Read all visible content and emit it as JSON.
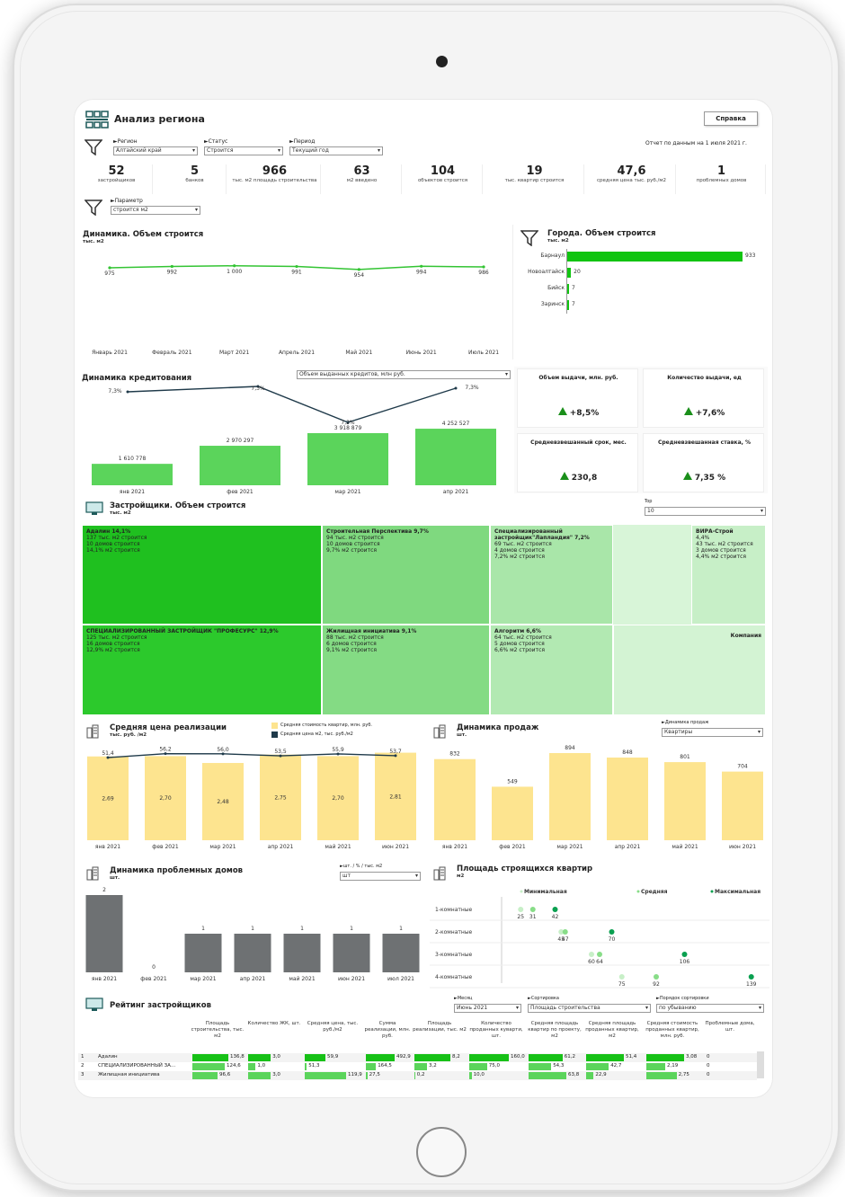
{
  "header": {
    "title": "Анализ региона",
    "help_button": "Справка",
    "report_date": "Отчет по данным на 1 июля 2021 г."
  },
  "filters": {
    "region": {
      "label": "►Регион",
      "value": "Алтайский край"
    },
    "status": {
      "label": "►Статус",
      "value": "Строится"
    },
    "period": {
      "label": "►Период",
      "value": "Текущий год"
    },
    "param": {
      "label": "►Параметр",
      "value": "строится м2"
    }
  },
  "kpis": [
    {
      "value": "52",
      "label": "застройщиков"
    },
    {
      "value": "5",
      "label": "банков"
    },
    {
      "value": "966",
      "label": "тыс. м2 площадь строительства"
    },
    {
      "value": "63",
      "label": "м2 введено"
    },
    {
      "value": "104",
      "label": "объектов строится"
    },
    {
      "value": "19",
      "label": "тыс. квартир строится"
    },
    {
      "value": "47,6",
      "label": "средняя цена тыс. руб./м2"
    },
    {
      "value": "1",
      "label": "проблемных домов"
    }
  ],
  "dynamics": {
    "title": "Динамика. Объем строится",
    "unit": "тыс. м2",
    "chart_data": {
      "type": "line",
      "categories": [
        "Январь 2021",
        "Февраль 2021",
        "Март 2021",
        "Апрель 2021",
        "Май 2021",
        "Июнь 2021",
        "Июль 2021"
      ],
      "values": [
        975,
        992,
        1000,
        991,
        954,
        994,
        986
      ],
      "labels": [
        "975",
        "992",
        "1 000",
        "991",
        "954",
        "994",
        "986"
      ],
      "ylim": [
        0,
        1100
      ]
    }
  },
  "cities": {
    "title": "Города. Объем строится",
    "unit": "тыс. м2",
    "chart_data": {
      "type": "bar",
      "categories": [
        "Барнаул",
        "Новоалтайск",
        "Бийск",
        "Заринск"
      ],
      "values": [
        933,
        20,
        7,
        7
      ]
    }
  },
  "credit": {
    "title": "Динамика кредитования",
    "dropdown": "Объем выданных кредитов, млн руб.",
    "chart_data": {
      "type": "bar",
      "categories": [
        "янв 2021",
        "фев 2021",
        "мар 2021",
        "апр 2021"
      ],
      "values": [
        1610778,
        2970297,
        3918879,
        4252527
      ],
      "labels": [
        "1 610 778",
        "2 970 297",
        "3 918 879",
        "4 252 527"
      ],
      "rate_line": [
        7.3,
        7.3,
        7.2,
        7.3
      ],
      "rate_labels": [
        "7,3%",
        "7,3%",
        "7,2%",
        "7,3%"
      ]
    }
  },
  "credit_kpis": [
    {
      "title": "Объем выдачи, млн. руб.",
      "value": "+8,5%"
    },
    {
      "title": "Количество выдачи, ед",
      "value": "+7,6%"
    },
    {
      "title": "Средневзвешанный срок, мес.",
      "value": "230,8"
    },
    {
      "title": "Средневзвешанная ставка, %",
      "value": "7,35 %"
    }
  ],
  "developers": {
    "title": "Застройщики. Объем строится",
    "unit": "тыс. м2",
    "top_label": "Top",
    "top_value": "10",
    "cells": [
      {
        "name": "Адалин  14,1%",
        "l1": "137 тыс. м2 строится",
        "l2": "10 домов строится",
        "l3": "14,1%  м2 строится",
        "color": "#1fc01f"
      },
      {
        "name": "СПЕЦИАЛИЗИРОВАННЫЙ ЗАСТРОЙЩИК \"ПРОФЕСУРС\"  12,9%",
        "l1": "125 тыс. м2 строится",
        "l2": "16 домов строится",
        "l3": "12,9%  м2 строится",
        "color": "#2cc92c"
      },
      {
        "name": "Строительная Перспектива  9,7%",
        "l1": "94 тыс. м2 строится",
        "l2": "10 домов строится",
        "l3": "9,7%  м2 строится",
        "color": "#7fd97f"
      },
      {
        "name": "Жилищная инициатива  9,1%",
        "l1": "88 тыс. м2 строится",
        "l2": "6 домов строится",
        "l3": "9,1%  м2 строится",
        "color": "#84db84"
      },
      {
        "name": "Специализированный застройщик\"Лапландия\"  7,2%",
        "l1": "69 тыс. м2 строится",
        "l2": "4 домов строится",
        "l3": "7,2%  м2 строится",
        "color": "#a9e6a9"
      },
      {
        "name": "Алгоритм  6,6%",
        "l1": "64 тыс. м2 строится",
        "l2": "5 домов строится",
        "l3": "6,6%  м2 строится",
        "color": "#b2e9b2"
      },
      {
        "name": "ВИРА-Строй",
        "l1": "4,4%",
        "l2": "43 тыс. м2 строится",
        "l3": "3 домов строится",
        "l4": "4,4%  м2 строится",
        "color": "#c7efc7"
      },
      {
        "name": "Компания",
        "color": "#d3f3d3"
      }
    ]
  },
  "avg_price": {
    "title": "Средняя цена реализации",
    "unit": "тыс. руб. /м2",
    "legend1": "Средняя стоимость квартир, млн. руб.",
    "legend2": "Средняя цена м2, тыс. руб./м2",
    "chart_data": {
      "type": "bar",
      "categories": [
        "янв 2021",
        "фев 2021",
        "мар 2021",
        "апр 2021",
        "май 2021",
        "июн 2021"
      ],
      "series": [
        {
          "name": "Средняя стоимость квартир, млн. руб.",
          "values": [
            2.69,
            2.7,
            2.48,
            2.75,
            2.7,
            2.81
          ],
          "labels": [
            "2,69",
            "2,70",
            "2,48",
            "2,75",
            "2,70",
            "2,81"
          ]
        },
        {
          "name": "Средняя цена м2, тыс. руб./м2",
          "values": [
            51.4,
            56.2,
            56.0,
            53.5,
            55.9,
            53.7
          ],
          "labels": [
            "51,4",
            "56,2",
            "56,0",
            "53,5",
            "55,9",
            "53,7"
          ]
        }
      ]
    }
  },
  "sales": {
    "title": "Динамика продаж",
    "unit": "шт.",
    "dd_label": "►Динамика продаж",
    "dd_value": "Квартиры",
    "chart_data": {
      "type": "bar",
      "categories": [
        "янв 2021",
        "фев 2021",
        "мар 2021",
        "апр 2021",
        "май 2021",
        "июн 2021"
      ],
      "values": [
        832,
        549,
        894,
        848,
        801,
        704
      ]
    }
  },
  "problem": {
    "title": "Динамика проблемных домов",
    "unit": "шт.",
    "dd_label": "►шт. / % / тыс. м2",
    "dd_value": "шт",
    "chart_data": {
      "type": "bar",
      "categories": [
        "янв 2021",
        "фев 2021",
        "мар 2021",
        "апр 2021",
        "май 2021",
        "июн 2021",
        "июл 2021"
      ],
      "values": [
        2,
        0,
        1,
        1,
        1,
        1,
        1
      ]
    }
  },
  "area": {
    "title": "Площадь строящихся квартир",
    "unit": "м2",
    "leg_min": "Минимальная",
    "leg_avg": "Средняя",
    "leg_max": "Максимальная",
    "chart_data": {
      "type": "scatter",
      "categories": [
        "1-комнатные",
        "2-комнатные",
        "3-комнатные",
        "4-комнатные"
      ],
      "min": [
        25,
        45,
        60,
        75
      ],
      "avg": [
        31,
        47,
        64,
        92
      ],
      "max": [
        42,
        70,
        106,
        139
      ],
      "min_labels": [
        "25",
        "45",
        "60",
        "75"
      ],
      "avg_labels": [
        "31",
        "47",
        "64",
        "92"
      ],
      "max_labels": [
        "42",
        "70",
        "106",
        "139"
      ]
    }
  },
  "rating": {
    "title": "Рейтинг застройщиков",
    "f1_label": "►Месяц",
    "f1_value": "Июнь 2021",
    "f2_label": "►Сортировка",
    "f2_value": "Площадь строительства",
    "f3_label": "►Порядок сортировки",
    "f3_value": "по убыванию",
    "columns": [
      "Площадь строительства, тыс. м2",
      "Количество ЖК, шт.",
      "Средняя цена, тыс. руб./м2",
      "Сумма реализации, млн. руб.",
      "Площадь реализации, тыс. м2",
      "Количество проданных куварти, шт.",
      "Средняя площадь квартир по проекту, м2",
      "Средняя площадь проданных квартир, м2",
      "Средняя стоимость проданных квартир, млн. руб.",
      "Проблемные дома, шт."
    ],
    "rows": [
      {
        "n": "1",
        "name": "Адалин",
        "cells": [
          "136,8",
          "3,0",
          "59,9",
          "492,9",
          "8,2",
          "160,0",
          "61,2",
          "51,4",
          "3,08",
          "0"
        ],
        "fills": [
          1,
          0.6,
          0.5,
          1,
          1,
          1,
          0.9,
          1,
          1,
          0
        ]
      },
      {
        "n": "2",
        "name": "СПЕЦИАЛИЗИРОВАННЫЙ ЗА...",
        "cells": [
          "124,6",
          "1,0",
          "51,3",
          "164,5",
          "3,2",
          "75,0",
          "54,3",
          "42,7",
          "2,19",
          "0"
        ],
        "fills": [
          0.9,
          0.2,
          0.05,
          0.35,
          0.35,
          0.45,
          0.6,
          0.6,
          0.5,
          0
        ]
      },
      {
        "n": "3",
        "name": "Жилищная инициатива",
        "cells": [
          "96,6",
          "3,0",
          "119,9",
          "27,5",
          "0,2",
          "10,0",
          "63,8",
          "22,9",
          "2,75",
          "0"
        ],
        "fills": [
          0.7,
          0.6,
          1,
          0.05,
          0.02,
          0.06,
          1,
          0.2,
          0.8,
          0
        ]
      }
    ]
  },
  "colors": {
    "green": "#1fc01f",
    "bright": "#3ad13a",
    "yellow": "#fde48f",
    "gray": "#6e7173",
    "navy": "#1f3a4a"
  }
}
